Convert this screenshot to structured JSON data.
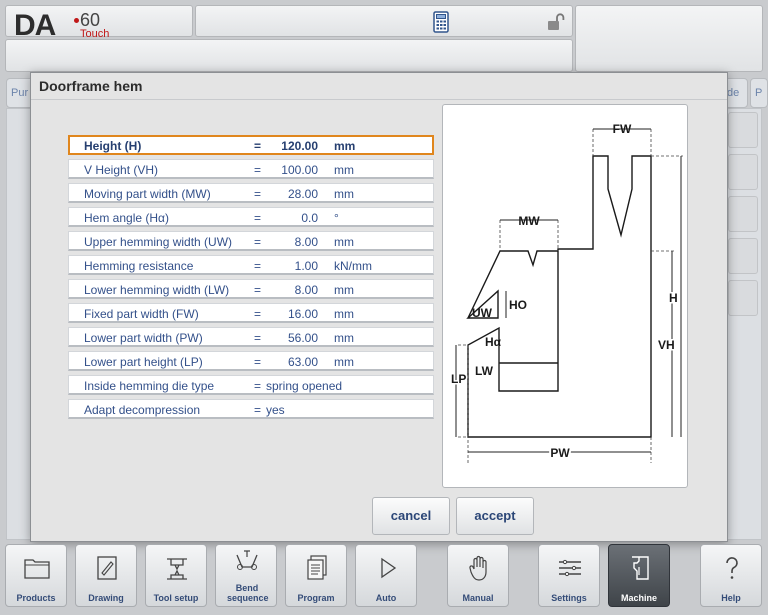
{
  "header": {
    "logo_main": "DA",
    "logo_number": "60",
    "logo_sub": "Touch"
  },
  "background_tabs": {
    "left_tab": "Pur",
    "right_tab_a": "de",
    "right_tab_b": "P"
  },
  "dialog": {
    "title": "Doorframe hem",
    "parameters": [
      {
        "label": "Height (H)",
        "eq": "=",
        "value": "120.00",
        "unit": "mm"
      },
      {
        "label": "V Height (VH)",
        "eq": "=",
        "value": "100.00",
        "unit": "mm"
      },
      {
        "label": "Moving part width (MW)",
        "eq": "=",
        "value": "28.00",
        "unit": "mm"
      },
      {
        "label": "Hem angle (Hα)",
        "eq": "=",
        "value": "0.0",
        "unit": "°"
      },
      {
        "label": "Upper hemming width (UW)",
        "eq": "=",
        "value": "8.00",
        "unit": "mm"
      },
      {
        "label": "Hemming resistance",
        "eq": "=",
        "value": "1.00",
        "unit": "kN/mm"
      },
      {
        "label": "Lower hemming width (LW)",
        "eq": "=",
        "value": "8.00",
        "unit": "mm"
      },
      {
        "label": "Fixed part width (FW)",
        "eq": "=",
        "value": "16.00",
        "unit": "mm"
      },
      {
        "label": "Lower part width (PW)",
        "eq": "=",
        "value": "56.00",
        "unit": "mm"
      },
      {
        "label": "Lower part height (LP)",
        "eq": "=",
        "value": "63.00",
        "unit": "mm"
      },
      {
        "label": "Inside hemming die type",
        "eq": "=",
        "value": "spring opened",
        "unit": ""
      },
      {
        "label": "Adapt decompression",
        "eq": "=",
        "value": "yes",
        "unit": ""
      }
    ],
    "diagram_labels": {
      "fw": "FW",
      "mw": "MW",
      "ho": "HO",
      "uw": "UW",
      "ha": "Hα",
      "lw": "LW",
      "lp": "LP",
      "pw": "PW",
      "h": "H",
      "vh": "VH"
    },
    "cancel_label": "cancel",
    "accept_label": "accept"
  },
  "toolbar": [
    {
      "label": "Products",
      "icon": "folder-icon",
      "active": false
    },
    {
      "label": "Drawing",
      "icon": "drawing-icon",
      "active": false
    },
    {
      "label": "Tool setup",
      "icon": "tool-setup-icon",
      "active": false
    },
    {
      "label": "Bend sequence",
      "icon": "bend-sequence-icon",
      "active": false
    },
    {
      "label": "Program",
      "icon": "program-icon",
      "active": false
    },
    {
      "label": "Auto",
      "icon": "play-icon",
      "active": false
    },
    {
      "label": "Manual",
      "icon": "hand-icon",
      "active": false
    },
    {
      "label": "Settings",
      "icon": "settings-list-icon",
      "active": false
    },
    {
      "label": "Machine",
      "icon": "machine-icon",
      "active": true
    },
    {
      "label": "Help",
      "icon": "help-icon",
      "active": false
    }
  ],
  "colors": {
    "accent": "#e0861d",
    "text": "#2b4a7c",
    "active_tab": "#4a4f55"
  }
}
